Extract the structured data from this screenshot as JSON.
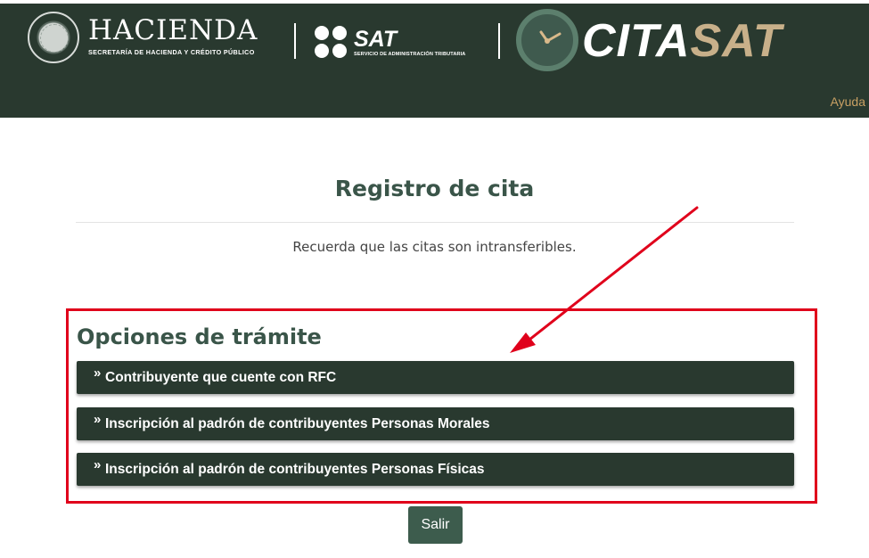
{
  "header": {
    "hacienda_name": "HACIENDA",
    "hacienda_subtitle": "SECRETARÍA DE HACIENDA Y CRÉDITO PÚBLICO",
    "sat_name": "SAT",
    "sat_subtitle": "SERVICIO DE ADMINISTRACIÓN TRIBUTARIA",
    "citasat_part1": "CITA",
    "citasat_part2": "SAT",
    "help_link": "Ayuda"
  },
  "main": {
    "title": "Registro de cita",
    "notice": "Recuerda que las citas son intransferibles.",
    "options_heading": "Opciones de trámite",
    "options": [
      {
        "chevron": "»",
        "label": "Contribuyente que cuente con RFC"
      },
      {
        "chevron": "»",
        "label": "Inscripción al padrón de contribuyentes Personas Morales"
      },
      {
        "chevron": "»",
        "label": "Inscripción al padrón de contribuyentes Personas Físicas"
      }
    ],
    "exit_button": "Salir"
  },
  "colors": {
    "header_bg": "#29392f",
    "accent_gold": "#c8b08a",
    "highlight_red": "#e0001b",
    "title_green": "#3a5549"
  }
}
